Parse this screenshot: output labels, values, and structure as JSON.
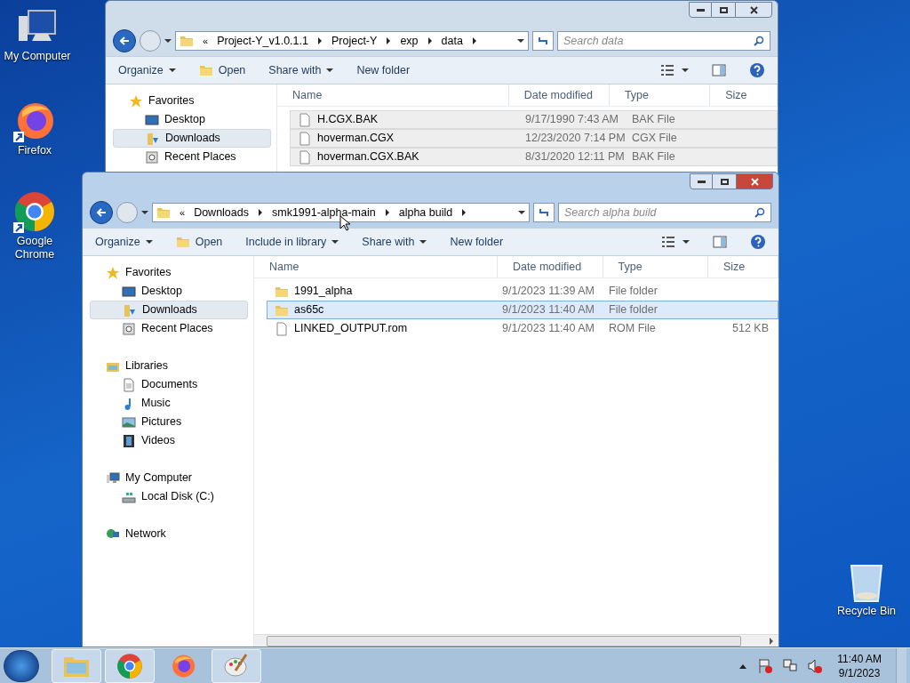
{
  "desktop_icons": [
    {
      "label": "My Computer",
      "kind": "computer",
      "shortcut": false
    },
    {
      "label": "Firefox",
      "kind": "firefox",
      "shortcut": true
    },
    {
      "label": "Google Chrome",
      "kind": "chrome",
      "shortcut": true
    },
    {
      "label": "Recycle Bin",
      "kind": "recycle",
      "shortcut": false
    }
  ],
  "windows": [
    {
      "active": false,
      "address_overflow": "«",
      "address": [
        "Project-Y_v1.0.1.1",
        "Project-Y",
        "exp",
        "data"
      ],
      "search_placeholder": "Search data",
      "toolbar": [
        {
          "label": "Organize",
          "kind": "menu"
        },
        {
          "label": "Open",
          "kind": "open"
        },
        {
          "label": "Share with",
          "kind": "menu"
        },
        {
          "label": "New folder",
          "kind": "plain"
        }
      ],
      "nav": [
        {
          "label": "Favorites",
          "selected": false,
          "children": [
            {
              "label": "Desktop",
              "selected": false
            },
            {
              "label": "Downloads",
              "selected": true
            },
            {
              "label": "Recent Places",
              "selected": false
            }
          ]
        }
      ],
      "columns": [
        "Name",
        "Date modified",
        "Type",
        "Size"
      ],
      "files": [
        {
          "name": "H.CGX.BAK",
          "kind": "file",
          "date": "9/17/1990 7:43 AM",
          "type": "BAK File",
          "selected": true
        },
        {
          "name": "hoverman.CGX",
          "kind": "file",
          "date": "12/23/2020 7:14 PM",
          "type": "CGX File",
          "selected": true
        },
        {
          "name": "hoverman.CGX.BAK",
          "kind": "file",
          "date": "8/31/2020 12:11 PM",
          "type": "BAK File",
          "selected": true
        }
      ]
    },
    {
      "active": true,
      "address_overflow": "«",
      "address": [
        "Downloads",
        "smk1991-alpha-main",
        "alpha build"
      ],
      "search_placeholder": "Search alpha build",
      "toolbar": [
        {
          "label": "Organize",
          "kind": "menu"
        },
        {
          "label": "Open",
          "kind": "open"
        },
        {
          "label": "Include in library",
          "kind": "menu"
        },
        {
          "label": "Share with",
          "kind": "menu"
        },
        {
          "label": "New folder",
          "kind": "plain"
        }
      ],
      "nav": [
        {
          "label": "Favorites",
          "selected": false,
          "children": [
            {
              "label": "Desktop",
              "selected": false
            },
            {
              "label": "Downloads",
              "selected": true
            },
            {
              "label": "Recent Places",
              "selected": false
            }
          ]
        },
        {
          "label": "Libraries",
          "selected": false,
          "children": [
            {
              "label": "Documents",
              "selected": false
            },
            {
              "label": "Music",
              "selected": false
            },
            {
              "label": "Pictures",
              "selected": false
            },
            {
              "label": "Videos",
              "selected": false
            }
          ]
        },
        {
          "label": "My Computer",
          "selected": false,
          "children": [
            {
              "label": "Local Disk (C:)",
              "selected": false
            }
          ]
        },
        {
          "label": "Network",
          "selected": false
        }
      ],
      "columns": [
        "Name",
        "Date modified",
        "Type",
        "Size"
      ],
      "files": [
        {
          "name": "1991_alpha",
          "kind": "folder",
          "date": "9/1/2023 11:39 AM",
          "type": "File folder",
          "selected": false
        },
        {
          "name": "as65c",
          "kind": "folder",
          "date": "9/1/2023 11:40 AM",
          "type": "File folder",
          "selected": true
        },
        {
          "name": "LINKED_OUTPUT.rom",
          "kind": "file",
          "date": "9/1/2023 11:40 AM",
          "type": "ROM File",
          "size": "512 KB",
          "selected": false
        }
      ]
    }
  ],
  "taskbar": {
    "items": [
      {
        "kind": "explorer",
        "running": true
      },
      {
        "kind": "chrome",
        "running": true
      },
      {
        "kind": "firefox",
        "running": false
      },
      {
        "kind": "paint",
        "running": true
      }
    ],
    "time": "11:40 AM",
    "date": "9/1/2023"
  }
}
